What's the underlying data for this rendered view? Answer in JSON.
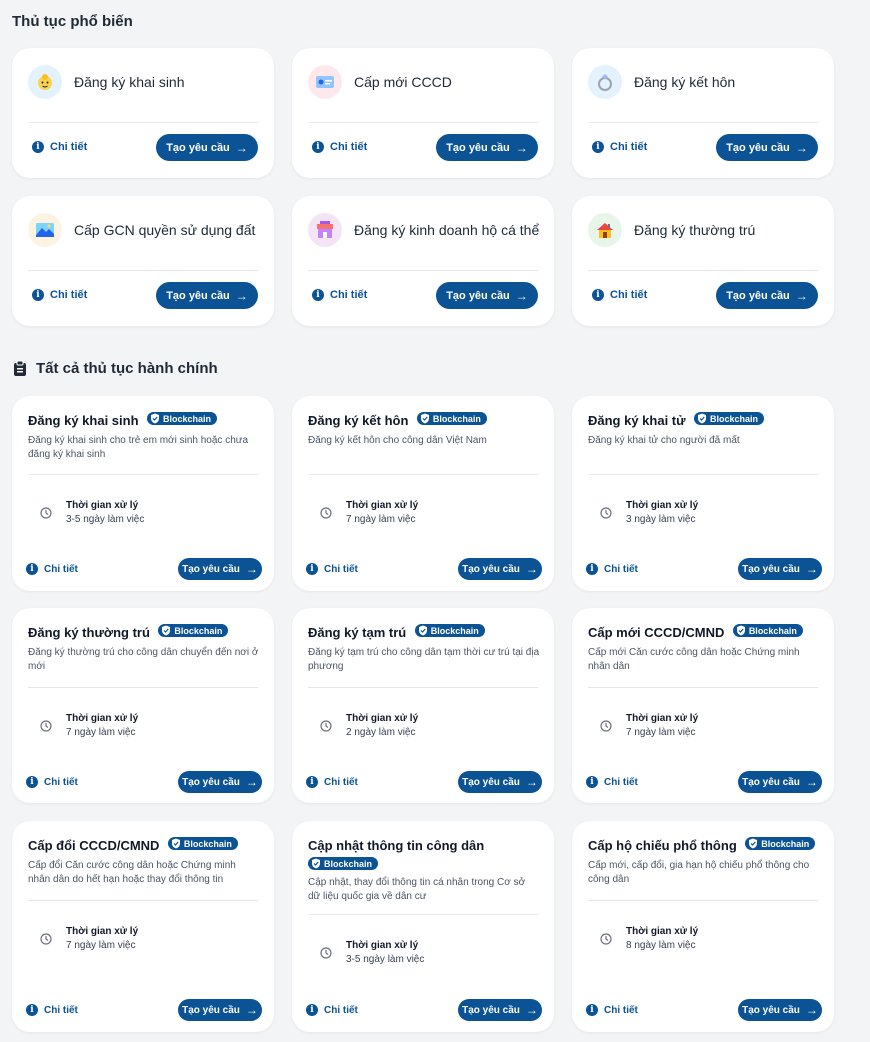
{
  "popular": {
    "title": "Thủ tục phổ biến",
    "detail_label": "Chi tiết",
    "request_label": "Tạo yêu cầu",
    "items": [
      {
        "title": "Đăng ký khai sinh",
        "icon": "baby-icon",
        "bg": "#e3f2fd"
      },
      {
        "title": "Cấp mới CCCD",
        "icon": "id-card-icon",
        "bg": "#fde8ec"
      },
      {
        "title": "Đăng ký kết hôn",
        "icon": "ring-icon",
        "bg": "#e3f2fd"
      },
      {
        "title": "Cấp GCN quyền sử dụng đất",
        "icon": "landscape-icon",
        "bg": "#fdf3e3"
      },
      {
        "title": "Đăng ký kinh doanh hộ cá thể",
        "icon": "shop-icon",
        "bg": "#f3e5f5"
      },
      {
        "title": "Đăng ký thường trú",
        "icon": "house-icon",
        "bg": "#e8f5e9"
      }
    ]
  },
  "all": {
    "title": "Tất cả thủ tục hành chính",
    "badge_label": "Blockchain",
    "time_label": "Thời gian xử lý",
    "detail_label": "Chi tiết",
    "request_label": "Tạo yêu cầu",
    "items": [
      {
        "title": "Đăng ký khai sinh",
        "desc": "Đăng ký khai sinh cho trẻ em mới sinh hoặc chưa đăng ký khai sinh",
        "time": "3-5 ngày làm việc"
      },
      {
        "title": "Đăng ký kết hôn",
        "desc": "Đăng ký kết hôn cho công dân Việt Nam",
        "time": "7 ngày làm việc"
      },
      {
        "title": "Đăng ký khai tử",
        "desc": "Đăng ký khai tử cho người đã mất",
        "time": "3 ngày làm việc"
      },
      {
        "title": "Đăng ký thường trú",
        "desc": "Đăng ký thường trú cho công dân chuyển đến nơi ở mới",
        "time": "7 ngày làm việc"
      },
      {
        "title": "Đăng ký tạm trú",
        "desc": "Đăng ký tạm trú cho công dân tạm thời cư trú tại địa phương",
        "time": "2 ngày làm việc"
      },
      {
        "title": "Cấp mới CCCD/CMND",
        "desc": "Cấp mới Căn cước công dân hoặc Chứng minh nhân dân",
        "time": "7 ngày làm việc"
      },
      {
        "title": "Cấp đổi CCCD/CMND",
        "desc": "Cấp đổi Căn cước công dân hoặc Chứng minh nhân dân do hết hạn hoặc thay đổi thông tin",
        "time": "7 ngày làm việc"
      },
      {
        "title": "Cập nhật thông tin công dân",
        "desc": "Cập nhật, thay đổi thông tin cá nhân trong Cơ sở dữ liệu quốc gia về dân cư",
        "time": "3-5 ngày làm việc"
      },
      {
        "title": "Cấp hộ chiếu phổ thông",
        "desc": "Cấp mới, cấp đổi, gia hạn hộ chiếu phổ thông cho công dân",
        "time": "8 ngày làm việc"
      }
    ]
  }
}
